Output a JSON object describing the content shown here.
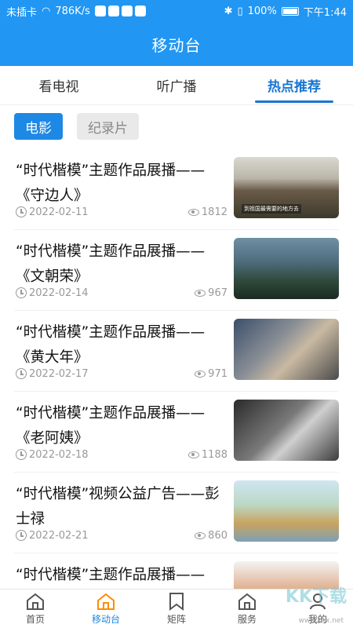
{
  "status_bar": {
    "carrier": "未插卡",
    "speed": "786K/s",
    "battery": "100%",
    "time": "下午1:44"
  },
  "header": {
    "title": "移动台"
  },
  "tabs": [
    {
      "label": "看电视",
      "active": false
    },
    {
      "label": "听广播",
      "active": false
    },
    {
      "label": "热点推荐",
      "active": true
    }
  ],
  "chips": [
    {
      "label": "电影",
      "active": true
    },
    {
      "label": "纪录片",
      "active": false
    }
  ],
  "items": [
    {
      "title": "“时代楷模”主题作品展播——《守边人》",
      "date": "2022-02-11",
      "views": "1812",
      "thumb_caption": "到祖国最需要的地方去"
    },
    {
      "title": "“时代楷模”主题作品展播——《文朝荣》",
      "date": "2022-02-14",
      "views": "967",
      "thumb_caption": ""
    },
    {
      "title": "“时代楷模”主题作品展播——《黄大年》",
      "date": "2022-02-17",
      "views": "971",
      "thumb_caption": ""
    },
    {
      "title": "“时代楷模”主题作品展播——《老阿姨》",
      "date": "2022-02-18",
      "views": "1188",
      "thumb_caption": ""
    },
    {
      "title": "“时代楷模”视频公益广告——彭士禄",
      "date": "2022-02-21",
      "views": "860",
      "thumb_caption": ""
    },
    {
      "title": "“时代楷模”主题作品展播——《幸福已来》",
      "date": "",
      "views": "",
      "thumb_caption": ""
    }
  ],
  "bottom_nav": [
    {
      "label": "首页",
      "icon": "home-icon",
      "active": false
    },
    {
      "label": "移动台",
      "icon": "home-icon",
      "active": true
    },
    {
      "label": "矩阵",
      "icon": "bookmark-icon",
      "active": false
    },
    {
      "label": "服务",
      "icon": "home-icon",
      "active": false
    },
    {
      "label": "我的",
      "icon": "user-icon",
      "active": false
    }
  ],
  "watermark": {
    "text": "KK下载",
    "url": "www.kkx.net"
  },
  "colors": {
    "primary": "#2196f3",
    "tab_active": "#1976d2",
    "chip_active": "#1e88e5"
  }
}
